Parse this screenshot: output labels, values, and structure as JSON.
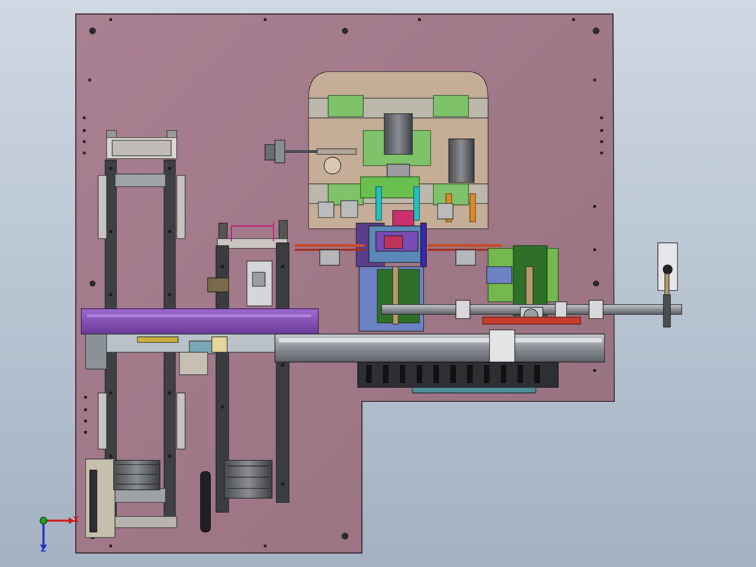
{
  "viewport": {
    "background_top": "#cfd8e3",
    "background_bottom": "#a3b1c2"
  },
  "colors": {
    "base_plate": "#a0788a",
    "base_plate_edge": "#3a2a32",
    "top_plate": "#c9b29c",
    "purple_beam": "#8a52b8",
    "green_blocks": "#7ec26a",
    "dark_green_module": "#2e6f2a",
    "blue_block": "#6d82c4",
    "rail_grey": "#5a5d62",
    "dark_rail": "#3a3c40",
    "red_accent": "#c63d2f",
    "cyan_accent": "#22c1c3",
    "orange_accent": "#d98a2a"
  },
  "triad": {
    "x_label": "X",
    "z_label": "Z",
    "x_color": "#d02020",
    "y_color": "#20a020",
    "z_color": "#2030c0"
  }
}
